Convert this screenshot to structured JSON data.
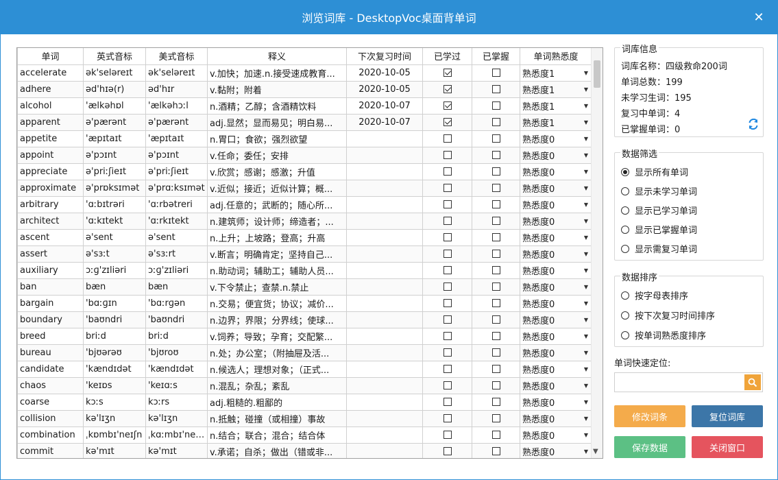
{
  "window": {
    "title": "浏览词库 - DesktopVoc桌面背单词",
    "close": "✕"
  },
  "grid": {
    "headers": [
      "单词",
      "英式音标",
      "美式音标",
      "释义",
      "下次复习时间",
      "已学过",
      "已掌握",
      "单词熟悉度"
    ],
    "rows": [
      {
        "word": "accelerate",
        "uk": "ək'seləreɪt",
        "us": "ək'seləreɪt",
        "meaning": "v.加快；加速.n.接受速成教育...",
        "next": "2020-10-05",
        "learned": true,
        "mastered": false,
        "fam": "熟悉度1"
      },
      {
        "word": "adhere",
        "uk": "əd'hɪə(r)",
        "us": "əd'hɪr",
        "meaning": "v.黏附；附着",
        "next": "2020-10-05",
        "learned": true,
        "mastered": false,
        "fam": "熟悉度1"
      },
      {
        "word": "alcohol",
        "uk": "'ælkəhɒl",
        "us": "'ælkəhɔːl",
        "meaning": "n.酒精；乙醇；含酒精饮料",
        "next": "2020-10-07",
        "learned": true,
        "mastered": false,
        "fam": "熟悉度1"
      },
      {
        "word": "apparent",
        "uk": "ə'pærənt",
        "us": "ə'pærənt",
        "meaning": "adj.显然；显而易见；明白易...",
        "next": "2020-10-07",
        "learned": true,
        "mastered": false,
        "fam": "熟悉度1"
      },
      {
        "word": "appetite",
        "uk": "'æpɪtaɪt",
        "us": "'æpɪtaɪt",
        "meaning": "n.胃口；食欲；强烈欲望",
        "next": "",
        "learned": false,
        "mastered": false,
        "fam": "熟悉度0"
      },
      {
        "word": "appoint",
        "uk": "ə'pɔɪnt",
        "us": "ə'pɔɪnt",
        "meaning": "v.任命；委任；安排",
        "next": "",
        "learned": false,
        "mastered": false,
        "fam": "熟悉度0"
      },
      {
        "word": "appreciate",
        "uk": "ə'priːʃieɪt",
        "us": "ə'priːʃieɪt",
        "meaning": "v.欣赏；感谢；感激；升值",
        "next": "",
        "learned": false,
        "mastered": false,
        "fam": "熟悉度0"
      },
      {
        "word": "approximate",
        "uk": "ə'prɒksɪmət",
        "us": "ə'prɑːksɪmət",
        "meaning": "v.近似；接近；近似计算；概...",
        "next": "",
        "learned": false,
        "mastered": false,
        "fam": "熟悉度0"
      },
      {
        "word": "arbitrary",
        "uk": "'ɑːbɪtrəri",
        "us": "'ɑːrbətreri",
        "meaning": "adj.任意的；武断的；随心所...",
        "next": "",
        "learned": false,
        "mastered": false,
        "fam": "熟悉度0"
      },
      {
        "word": "architect",
        "uk": "'ɑːkɪtekt",
        "us": "'ɑːrkɪtekt",
        "meaning": "n.建筑师；设计师；缔造者；...",
        "next": "",
        "learned": false,
        "mastered": false,
        "fam": "熟悉度0"
      },
      {
        "word": "ascent",
        "uk": "ə'sent",
        "us": "ə'sent",
        "meaning": "n.上升；上坡路；登高；升高",
        "next": "",
        "learned": false,
        "mastered": false,
        "fam": "熟悉度0"
      },
      {
        "word": "assert",
        "uk": "ə'sɜːt",
        "us": "ə'sɜːrt",
        "meaning": "v.断言；明确肯定；坚持自己...",
        "next": "",
        "learned": false,
        "mastered": false,
        "fam": "熟悉度0"
      },
      {
        "word": "auxiliary",
        "uk": "ɔːɡ'zɪliəri",
        "us": "ɔːɡ'zɪliəri",
        "meaning": "n.助动词；辅助工；辅助人员...",
        "next": "",
        "learned": false,
        "mastered": false,
        "fam": "熟悉度0"
      },
      {
        "word": "ban",
        "uk": "bæn",
        "us": "bæn",
        "meaning": "v.下令禁止；查禁.n.禁止",
        "next": "",
        "learned": false,
        "mastered": false,
        "fam": "熟悉度0"
      },
      {
        "word": "bargain",
        "uk": "'bɑːɡɪn",
        "us": "'bɑːrɡən",
        "meaning": "n.交易；便宜货；协议；减价...",
        "next": "",
        "learned": false,
        "mastered": false,
        "fam": "熟悉度0"
      },
      {
        "word": "boundary",
        "uk": "'baʊndri",
        "us": "'baʊndri",
        "meaning": "n.边界；界限；分界线；使球...",
        "next": "",
        "learned": false,
        "mastered": false,
        "fam": "熟悉度0"
      },
      {
        "word": "breed",
        "uk": "briːd",
        "us": "briːd",
        "meaning": "v.饲养；导致；孕育；交配繁...",
        "next": "",
        "learned": false,
        "mastered": false,
        "fam": "熟悉度0"
      },
      {
        "word": "bureau",
        "uk": "'bjʊərəʊ",
        "us": "'bjʊroʊ",
        "meaning": "n.处；办公室；（附抽屉及活...",
        "next": "",
        "learned": false,
        "mastered": false,
        "fam": "熟悉度0"
      },
      {
        "word": "candidate",
        "uk": "'kændɪdət",
        "us": "'kændɪdət",
        "meaning": "n.候选人；理想对象；（正式...",
        "next": "",
        "learned": false,
        "mastered": false,
        "fam": "熟悉度0"
      },
      {
        "word": "chaos",
        "uk": "'keɪɒs",
        "us": "'keɪɑːs",
        "meaning": "n.混乱；杂乱；紊乱",
        "next": "",
        "learned": false,
        "mastered": false,
        "fam": "熟悉度0"
      },
      {
        "word": "coarse",
        "uk": "kɔːs",
        "us": "kɔːrs",
        "meaning": "adj.粗糙的.粗鄙的",
        "next": "",
        "learned": false,
        "mastered": false,
        "fam": "熟悉度0"
      },
      {
        "word": "collision",
        "uk": "kə'lɪʒn",
        "us": "kə'lɪʒn",
        "meaning": "n.抵触；碰撞（或相撞）事故",
        "next": "",
        "learned": false,
        "mastered": false,
        "fam": "熟悉度0"
      },
      {
        "word": "combination",
        "uk": "ˌkɒmbɪ'neɪʃn",
        "us": "ˌkɑːmbɪ'neɪʃn",
        "meaning": "n.结合；联合；混合；结合体",
        "next": "",
        "learned": false,
        "mastered": false,
        "fam": "熟悉度0"
      },
      {
        "word": "commit",
        "uk": "kə'mɪt",
        "us": "kə'mɪt",
        "meaning": "v.承诺；自杀；做出（错或非...",
        "next": "",
        "learned": false,
        "mastered": false,
        "fam": "熟悉度0"
      }
    ]
  },
  "info": {
    "legend": "词库信息",
    "name_label": "词库名称：",
    "name_value": "四级救命200词",
    "total_label": "单词总数：",
    "total_value": "199",
    "unlearned_label": "未学习生词：",
    "unlearned_value": "195",
    "reviewing_label": "复习中单词：",
    "reviewing_value": "4",
    "mastered_label": "已掌握单词：",
    "mastered_value": "0"
  },
  "filter": {
    "legend": "数据筛选",
    "options": [
      "显示所有单词",
      "显示未学习单词",
      "显示已学习单词",
      "显示已掌握单词",
      "显示需复习单词"
    ],
    "selected": 0
  },
  "sort": {
    "legend": "数据排序",
    "options": [
      "按字母表排序",
      "按下次复习时间排序",
      "按单词熟悉度排序"
    ]
  },
  "locate": {
    "label": "单词快速定位:",
    "value": ""
  },
  "buttons": {
    "edit": "修改词条",
    "reset": "复位词库",
    "save": "保存数据",
    "close": "关闭窗口"
  },
  "colors": {
    "title_bar": "#2d8fd5",
    "edit": "#f4ab4b",
    "reset": "#3c76a8",
    "save": "#5cc084",
    "close": "#e5545e",
    "search_btn": "#f0a43a"
  }
}
